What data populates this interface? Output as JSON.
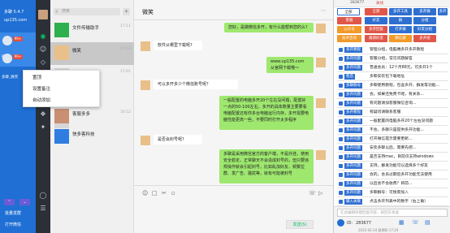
{
  "account_sidebar": {
    "version": "多聊 5.4.7",
    "site": "up135.com",
    "accounts": [
      {
        "name": "微笑"
      },
      {
        "name": "多聊_微笑"
      }
    ],
    "unread_badges": [
      "99+",
      "99+"
    ],
    "bottom_buttons": [
      "批量发群",
      "打开微信"
    ]
  },
  "wechat": {
    "search": {
      "placeholder": "搜索"
    },
    "conversations": [
      {
        "name": "文件传输助手",
        "time": "17:11"
      },
      {
        "name": "微笑",
        "time": "17:03"
      },
      {
        "name": "",
        "time": "17:01"
      },
      {
        "name": "",
        "time": ""
      },
      {
        "name": "",
        "time": ""
      },
      {
        "name": "客服多多",
        "time": "16:52"
      },
      {
        "name": "快多客科技",
        "time": ""
      }
    ],
    "context_menu": [
      "置顶",
      "设置备注",
      "自动添加"
    ],
    "chat": {
      "title": "微笑",
      "messages": [
        {
          "side": "right",
          "text": "您好，是做微信多开，有什么能帮到您的么？"
        },
        {
          "side": "left",
          "text": "软件从哪里下载呢?"
        },
        {
          "side": "right",
          "text": "www.up135.com\n从官网下载哦～"
        },
        {
          "side": "left",
          "text": "可以多开多少个微信账号呢？"
        },
        {
          "side": "right",
          "text": "一般配置的电脑多开20个左右没问题，配置好一点的50-100左右，多开的具体数量主要要看电脑配置还有你多台电脑运行内存，多开需要电脑性能更高一些，不要同时打开太多程序"
        },
        {
          "side": "left",
          "text": "是否会封号呢?"
        },
        {
          "side": "right",
          "text": "多聊是采用微信官方的客户端，不是外挂，使用安全稳定，正常聊天不会造成封号的，但只要违规操作就会引起封号，比如乱加好友、频繁拉群、发广告、骚扰等，就有可能被封号"
        }
      ],
      "send_label": "发送(S)"
    }
  },
  "assistant": {
    "topbar": {
      "id_label": "283677",
      "status": "离线"
    },
    "group_select": {
      "value": "全部"
    },
    "category_chips": [
      "全部",
      "多开工具",
      "多开群",
      "多开教程",
      "客服",
      "好友",
      "群",
      "分组",
      "公众号",
      "多开回复",
      "打开群",
      "好友分组",
      "技术咨询",
      "邀请好友",
      "微信群",
      "多开组"
    ],
    "replies": [
      {
        "tag": "多开教程",
        "text": "管理分组，电脑端多开多开教程"
      },
      {
        "tag": "多开问题",
        "text": "客服分组，常见问题解答"
      },
      {
        "tag": "多开问题",
        "text": "普通会员：12个月88元，可多开1个"
      },
      {
        "tag": "售后",
        "text": "多聊安装包下载地址"
      },
      {
        "tag": "多聊群号",
        "text": "多聊使用教程，包含多开、群发等功能..."
      },
      {
        "tag": "多开问题",
        "text": "会。如果还免费卡呢，有关系..."
      },
      {
        "tag": "多开问题",
        "text": "有问题请加客服微信咨询..."
      },
      {
        "tag": "多开教程",
        "text": "有疑问请联系客服"
      },
      {
        "tag": "多开问题",
        "text": "一般配置的电脑多开20个左右没问题"
      },
      {
        "tag": "多开问题",
        "text": "不会。多聊只是提供多开功能..."
      },
      {
        "tag": "多开问题",
        "text": "打开微信提示需要更新..."
      },
      {
        "tag": "多开问题",
        "text": "安装多聊以后，需要先把..."
      },
      {
        "tag": "多开问题",
        "text": "是否支持mac，目前仅支持windows"
      },
      {
        "tag": "多开问题",
        "text": "支持。群发功能可以选择多个好友"
      },
      {
        "tag": "多开问题",
        "text": "会的。会员过期后多开功能无法使用"
      },
      {
        "tag": "多开问题",
        "text": "以后会不会收费？目前..."
      },
      {
        "tag": "多开问题",
        "text": "多聊群号：可搜索加入"
      },
      {
        "tag": "输入关联",
        "text": "点击多开列表中的数字（右上角）"
      }
    ],
    "input": {
      "placeholder": "在此编辑快捷回复内容，按回车发送"
    },
    "footer": {
      "id_label": "ID:",
      "id_value": "283677",
      "time": "2022-02-24 星期四 17:24"
    }
  },
  "colors": {
    "brand_blue": "#1f6fd4",
    "wechat_green": "#9fe870",
    "chip_red": "#e0574a",
    "chip_orange": "#f29a2a",
    "chip_blue": "#2f6fd0"
  }
}
